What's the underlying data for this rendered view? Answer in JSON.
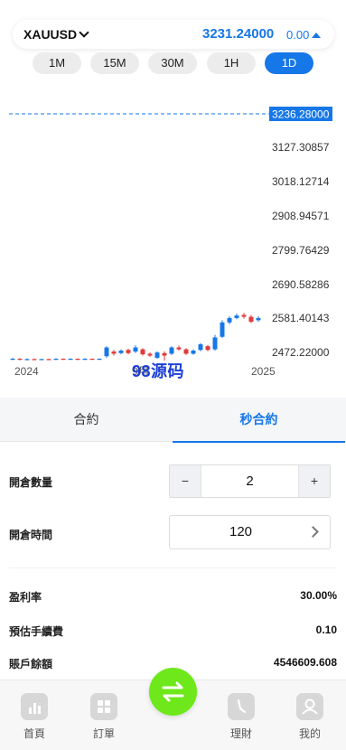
{
  "header": {
    "symbol": "XAUUSD",
    "price": "3231.24000",
    "change": "0.00",
    "change_color": "#1677e8"
  },
  "timeframes": [
    {
      "label": "1M",
      "active": false
    },
    {
      "label": "15M",
      "active": false
    },
    {
      "label": "30M",
      "active": false
    },
    {
      "label": "1H",
      "active": false
    },
    {
      "label": "1D",
      "active": true
    }
  ],
  "chart_data": {
    "type": "candlestick",
    "current_price_label": "3236.28000",
    "y_tick_labels": [
      "3127.30857",
      "3018.12714",
      "2908.94571",
      "2799.76429",
      "2690.58286",
      "2581.40143",
      "2472.22000"
    ],
    "x_tick_labels": [
      "2024",
      "9月",
      "2025"
    ],
    "up_color": "#1677e8",
    "down_color": "#e03a3a",
    "candles": [
      {
        "o": 2450,
        "c": 2452,
        "h": 2455,
        "l": 2448
      },
      {
        "o": 2452,
        "c": 2449,
        "h": 2454,
        "l": 2447
      },
      {
        "o": 2449,
        "c": 2451,
        "h": 2453,
        "l": 2447
      },
      {
        "o": 2451,
        "c": 2450,
        "h": 2453,
        "l": 2448
      },
      {
        "o": 2450,
        "c": 2451,
        "h": 2452,
        "l": 2448
      },
      {
        "o": 2451,
        "c": 2450,
        "h": 2452,
        "l": 2448
      },
      {
        "o": 2450,
        "c": 2452,
        "h": 2454,
        "l": 2448
      },
      {
        "o": 2452,
        "c": 2451,
        "h": 2453,
        "l": 2449
      },
      {
        "o": 2451,
        "c": 2452,
        "h": 2454,
        "l": 2449
      },
      {
        "o": 2452,
        "c": 2450,
        "h": 2453,
        "l": 2448
      },
      {
        "o": 2450,
        "c": 2452,
        "h": 2454,
        "l": 2448
      },
      {
        "o": 2452,
        "c": 2451,
        "h": 2453,
        "l": 2449
      },
      {
        "o": 2451,
        "c": 2452,
        "h": 2453,
        "l": 2450
      },
      {
        "o": 2460,
        "c": 2488,
        "h": 2492,
        "l": 2455
      },
      {
        "o": 2475,
        "c": 2468,
        "h": 2480,
        "l": 2462
      },
      {
        "o": 2470,
        "c": 2478,
        "h": 2482,
        "l": 2466
      },
      {
        "o": 2480,
        "c": 2470,
        "h": 2484,
        "l": 2466
      },
      {
        "o": 2475,
        "c": 2488,
        "h": 2495,
        "l": 2470
      },
      {
        "o": 2482,
        "c": 2466,
        "h": 2486,
        "l": 2462
      },
      {
        "o": 2468,
        "c": 2462,
        "h": 2472,
        "l": 2458
      },
      {
        "o": 2455,
        "c": 2472,
        "h": 2476,
        "l": 2452
      },
      {
        "o": 2470,
        "c": 2462,
        "h": 2476,
        "l": 2446
      },
      {
        "o": 2468,
        "c": 2488,
        "h": 2492,
        "l": 2464
      },
      {
        "o": 2488,
        "c": 2482,
        "h": 2494,
        "l": 2478
      },
      {
        "o": 2482,
        "c": 2468,
        "h": 2486,
        "l": 2464
      },
      {
        "o": 2468,
        "c": 2478,
        "h": 2482,
        "l": 2465
      },
      {
        "o": 2480,
        "c": 2498,
        "h": 2502,
        "l": 2476
      },
      {
        "o": 2492,
        "c": 2480,
        "h": 2496,
        "l": 2476
      },
      {
        "o": 2482,
        "c": 2520,
        "h": 2528,
        "l": 2478
      },
      {
        "o": 2522,
        "c": 2568,
        "h": 2575,
        "l": 2518
      },
      {
        "o": 2568,
        "c": 2582,
        "h": 2588,
        "l": 2562
      },
      {
        "o": 2582,
        "c": 2590,
        "h": 2596,
        "l": 2578
      },
      {
        "o": 2592,
        "c": 2586,
        "h": 2598,
        "l": 2580
      },
      {
        "o": 2586,
        "c": 2570,
        "h": 2592,
        "l": 2566
      },
      {
        "o": 2575,
        "c": 2582,
        "h": 2588,
        "l": 2570
      }
    ]
  },
  "watermark": "98源码",
  "tabs": [
    {
      "label": "合約",
      "active": false
    },
    {
      "label": "秒合約",
      "active": true
    }
  ],
  "form": {
    "quantity_label": "開倉數量",
    "quantity_value": "2",
    "minus": "−",
    "plus": "+",
    "time_label": "開倉時間",
    "time_value": "120"
  },
  "info": {
    "profit_rate_label": "盈利率",
    "profit_rate_value": "30.00%",
    "fee_label": "預估手續費",
    "fee_value": "0.10",
    "balance_label": "賬戶餘額",
    "balance_value": "4546609.608"
  },
  "nav": {
    "home": "首頁",
    "orders": "訂單",
    "finance": "理財",
    "mine": "我的"
  }
}
